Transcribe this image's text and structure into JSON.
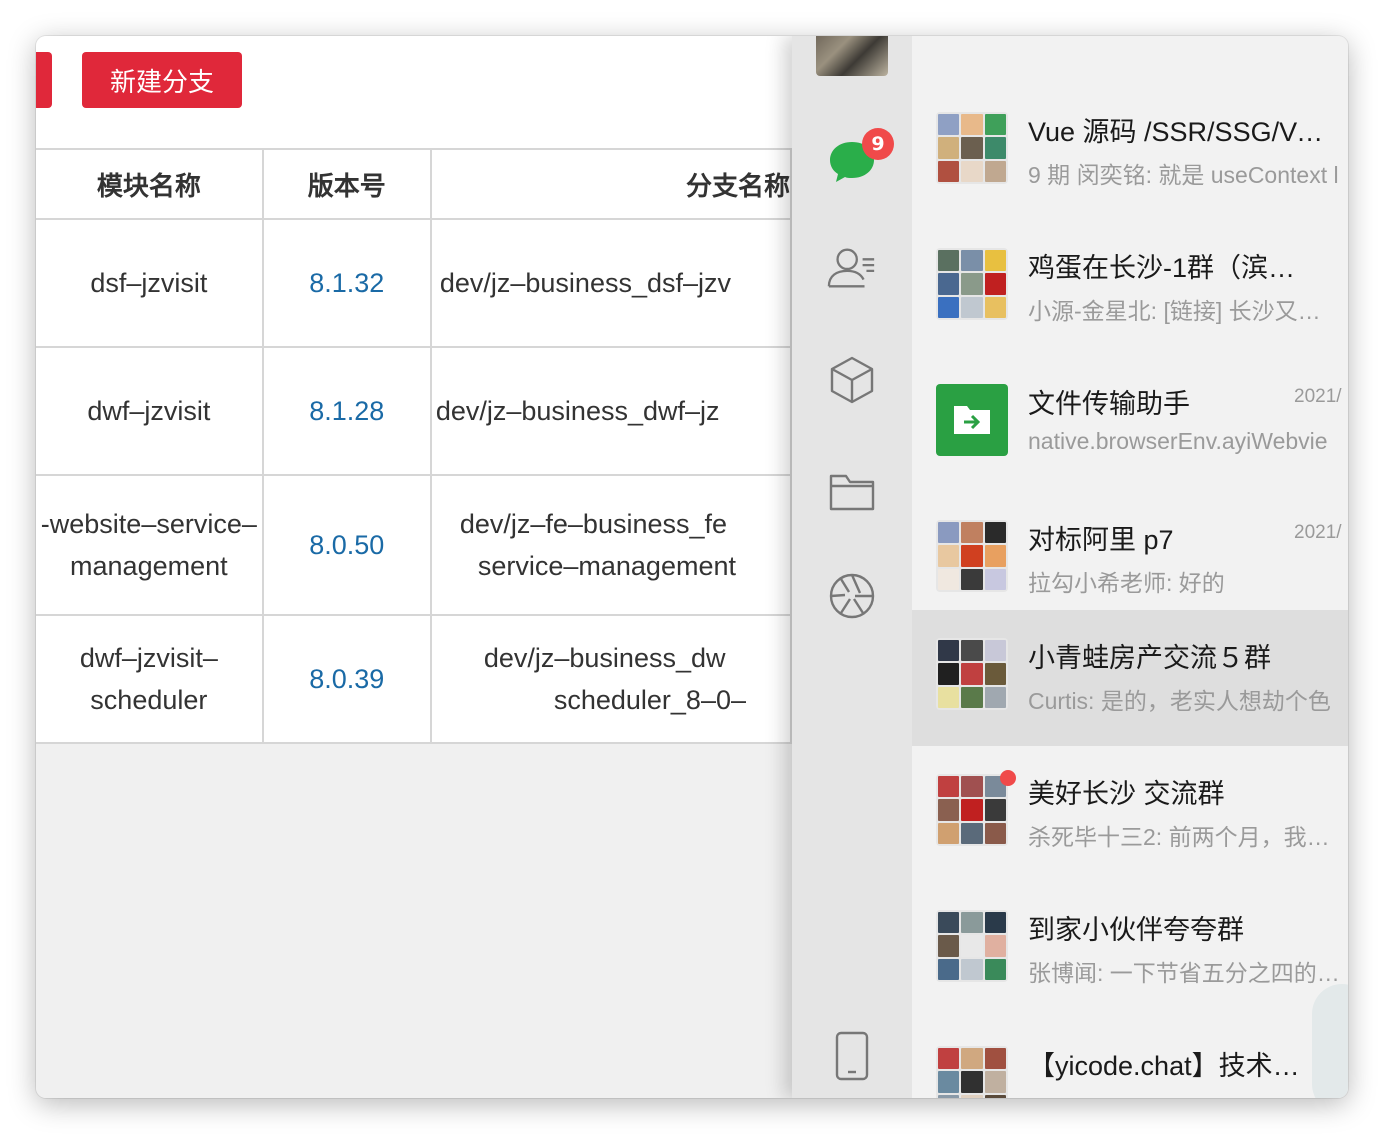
{
  "toolbar": {
    "new_branch_label": "新建分支"
  },
  "table": {
    "headers": [
      "模块名称",
      "版本号",
      "分支名称"
    ],
    "rows": [
      {
        "module": "dsf–jzvisit",
        "version": "8.1.32",
        "branch": "dev/jz–business_dsf–jzv"
      },
      {
        "module": "dwf–jzvisit",
        "version": "8.1.28",
        "branch": "dev/jz–business_dwf–jz"
      },
      {
        "module_line1": "-website–service–",
        "module_line2": "management",
        "version": "8.0.50",
        "branch_line1": "dev/jz–fe–business_fe",
        "branch_line2": "service–management"
      },
      {
        "module_line1": "dwf–jzvisit–",
        "module_line2": "scheduler",
        "version": "8.0.39",
        "branch_line1": "dev/jz–business_dw",
        "branch_line2": "scheduler_8–0–"
      }
    ]
  },
  "rail": {
    "unread_badge": "9",
    "accent": "#2aae4a"
  },
  "chats": [
    {
      "name": "Vue 源码 /SSR/SSG/Vu…",
      "message": "9 期 闵奕铭: 就是 useContext l",
      "time": ""
    },
    {
      "name": "鸡蛋在长沙-1群（滨…",
      "message": "小源-金星北: [链接] 长沙又…",
      "time": ""
    },
    {
      "name": "文件传输助手",
      "message": "native.browserEnv.ayiWebvie",
      "time": "2021/"
    },
    {
      "name": "对标阿里 p7",
      "message": "拉勾小希老师: 好的",
      "time": "2021/"
    },
    {
      "name": "小青蛙房产交流５群",
      "message": "Curtis: 是的，老实人想劫个色",
      "time": ""
    },
    {
      "name": "美好长沙 交流群",
      "message": "杀死毕十三2: 前两个月，我…",
      "time": ""
    },
    {
      "name": "到家小伙伴夸夸群",
      "message": "张博闻: 一下节省五分之四的…",
      "time": ""
    },
    {
      "name": "【yicode.chat】技术…",
      "message": "",
      "time": ""
    }
  ],
  "colors": {
    "brand_red": "#e0283a",
    "version_blue": "#1a6aa6",
    "wechat_green": "#2aae4a",
    "badge_red": "#f04a4a"
  }
}
